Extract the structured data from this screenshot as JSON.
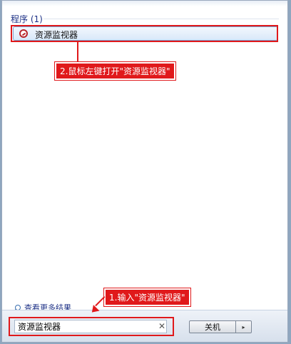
{
  "section": {
    "title": "程序 (1)"
  },
  "result": {
    "label": "资源监视器",
    "icon": "resource-monitor-icon"
  },
  "annotations": {
    "step2": "2.鼠标左键打开\"资源监视器\"",
    "step1": "1.输入\"资源监视器\""
  },
  "more_results": {
    "label": "查看更多结果",
    "icon": "search-icon"
  },
  "search": {
    "value": "资源监视器",
    "clear_icon": "close-icon"
  },
  "shutdown": {
    "label": "关机",
    "arrow": "▸"
  },
  "colors": {
    "annotation_red": "#e0191b",
    "title_blue": "#1e3287"
  }
}
